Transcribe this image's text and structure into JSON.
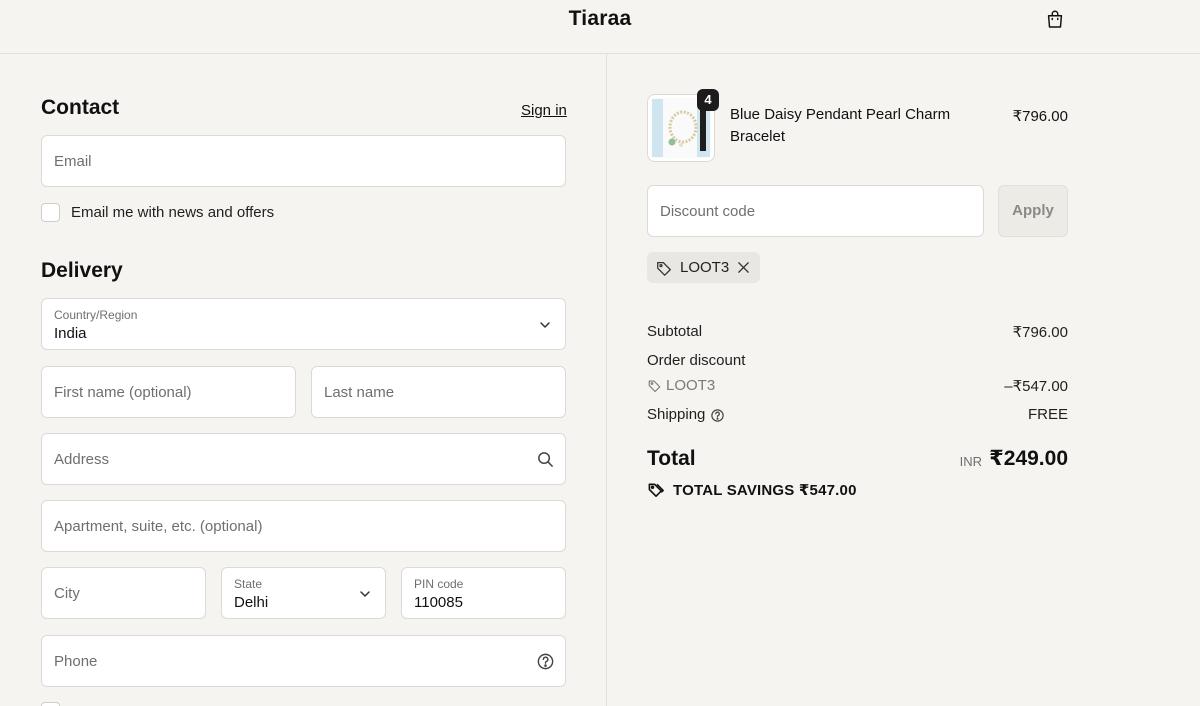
{
  "header": {
    "brand": "Tiaraa",
    "cart_icon": "shopping-bag-icon"
  },
  "contact": {
    "title": "Contact",
    "sign_in": "Sign in",
    "email_placeholder": "Email",
    "news_checkbox_label": "Email me with news and offers",
    "news_checked": false
  },
  "delivery": {
    "title": "Delivery",
    "country": {
      "label": "Country/Region",
      "value": "India"
    },
    "first_name_placeholder": "First name (optional)",
    "last_name_placeholder": "Last name",
    "address_placeholder": "Address",
    "apartment_placeholder": "Apartment, suite, etc. (optional)",
    "city_placeholder": "City",
    "state": {
      "label": "State",
      "value": "Delhi"
    },
    "pin": {
      "label": "PIN code",
      "value": "110085"
    },
    "phone_placeholder": "Phone"
  },
  "summary": {
    "product": {
      "name": "Blue Daisy Pendant Pearl Charm Bracelet",
      "quantity": "4",
      "price": "₹796.00"
    },
    "discount_placeholder": "Discount code",
    "apply_label": "Apply",
    "applied_code": "LOOT3",
    "subtotal_label": "Subtotal",
    "subtotal_value": "₹796.00",
    "order_discount_label": "Order discount",
    "discount_code": "LOOT3",
    "discount_value": "–₹547.00",
    "shipping_label": "Shipping",
    "shipping_value": "FREE",
    "total_label": "Total",
    "currency": "INR",
    "total_value": "₹249.00",
    "savings_label": "TOTAL SAVINGS",
    "savings_value": "₹547.00"
  },
  "colors": {
    "background": "#f5f4f1",
    "field": "#ffffff",
    "border": "#dcdad5",
    "text": "#1f1f1f",
    "muted": "#6f6f6f"
  }
}
